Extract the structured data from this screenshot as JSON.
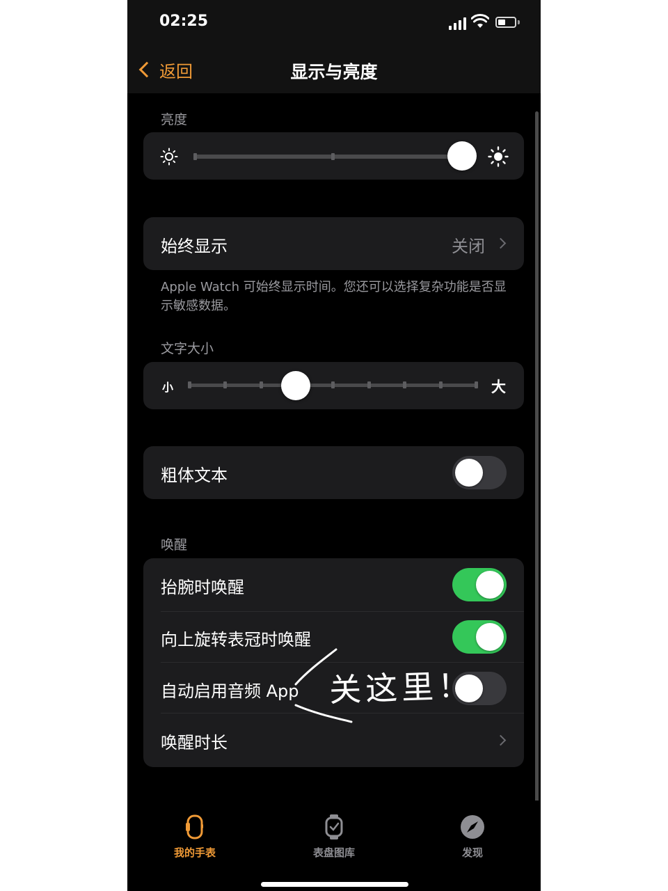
{
  "status_bar": {
    "time": "02:25"
  },
  "nav": {
    "back_label": "返回",
    "title": "显示与亮度"
  },
  "brightness": {
    "header": "亮度",
    "level": 0.9
  },
  "always_on": {
    "label": "始终显示",
    "value": "关闭"
  },
  "always_on_footnote": "Apple Watch 可始终显示时间。您还可以选择复杂功能是否显示敏感数据。",
  "text_size": {
    "header": "文字大小",
    "small_label": "小",
    "large_label": "大",
    "steps": 9,
    "selected_step": 3
  },
  "bold_text": {
    "label": "粗体文本",
    "on": false
  },
  "wake": {
    "header": "唤醒",
    "rows": [
      {
        "label": "抬腕时唤醒",
        "on": true
      },
      {
        "label": "向上旋转表冠时唤醒",
        "on": true
      },
      {
        "label": "自动启用音频 App",
        "on": false
      },
      {
        "label": "唤醒时长"
      }
    ]
  },
  "annotation": {
    "text": "关这里！"
  },
  "tab_bar": {
    "tabs": [
      {
        "label": "我的手表",
        "icon": "watch-icon",
        "active": true
      },
      {
        "label": "表盘图库",
        "icon": "watch-face-gallery-icon",
        "active": false
      },
      {
        "label": "发现",
        "icon": "compass-icon",
        "active": false
      }
    ]
  },
  "colors": {
    "accent": "#f09a36",
    "toggle_on": "#34c759",
    "toggle_off": "#39393d",
    "card": "#1c1c1e",
    "background": "#000000"
  }
}
